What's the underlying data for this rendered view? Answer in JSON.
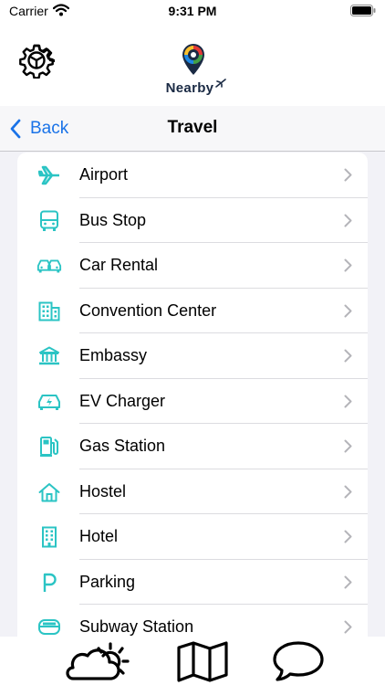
{
  "status_bar": {
    "carrier": "Carrier",
    "time": "9:31 PM"
  },
  "header": {
    "logo_text": "Nearby",
    "settings_icon": "gear-icon"
  },
  "nav": {
    "back_label": "Back",
    "title": "Travel"
  },
  "colors": {
    "accent": "#2bc4c4",
    "link": "#1a73e8"
  },
  "items": [
    {
      "label": "Airport",
      "icon": "airplane-icon"
    },
    {
      "label": "Bus Stop",
      "icon": "bus-icon"
    },
    {
      "label": "Car Rental",
      "icon": "cars-icon"
    },
    {
      "label": "Convention Center",
      "icon": "building-icon"
    },
    {
      "label": "Embassy",
      "icon": "bank-icon"
    },
    {
      "label": "EV Charger",
      "icon": "ev-car-icon"
    },
    {
      "label": "Gas Station",
      "icon": "fuel-pump-icon"
    },
    {
      "label": "Hostel",
      "icon": "house-icon"
    },
    {
      "label": "Hotel",
      "icon": "hotel-icon"
    },
    {
      "label": "Parking",
      "icon": "parking-icon"
    },
    {
      "label": "Subway Station",
      "icon": "tram-icon"
    }
  ],
  "tabs": [
    {
      "icon": "weather-icon"
    },
    {
      "icon": "map-icon"
    },
    {
      "icon": "chat-bubble-icon"
    }
  ]
}
